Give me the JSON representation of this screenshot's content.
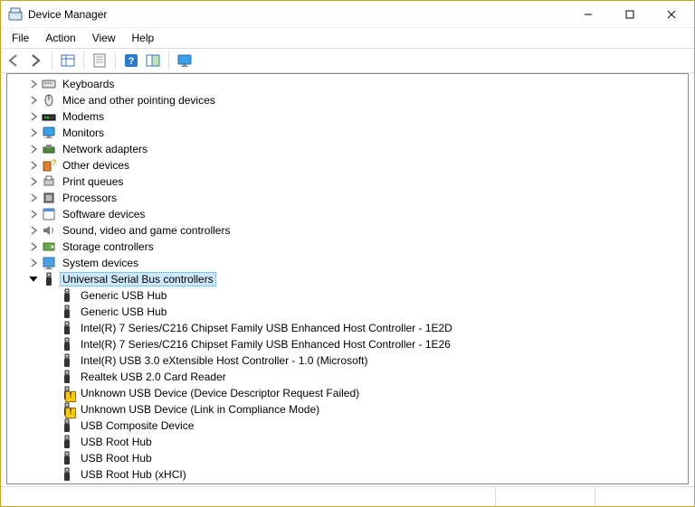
{
  "window": {
    "title": "Device Manager"
  },
  "menu": {
    "file": "File",
    "action": "Action",
    "view": "View",
    "help": "Help"
  },
  "categories": [
    {
      "icon": "keyboard",
      "label": "Keyboards"
    },
    {
      "icon": "mouse",
      "label": "Mice and other pointing devices"
    },
    {
      "icon": "modem",
      "label": "Modems"
    },
    {
      "icon": "monitor",
      "label": "Monitors"
    },
    {
      "icon": "network",
      "label": "Network adapters"
    },
    {
      "icon": "other",
      "label": "Other devices"
    },
    {
      "icon": "printer",
      "label": "Print queues"
    },
    {
      "icon": "processor",
      "label": "Processors"
    },
    {
      "icon": "software",
      "label": "Software devices"
    },
    {
      "icon": "sound",
      "label": "Sound, video and game controllers"
    },
    {
      "icon": "storage",
      "label": "Storage controllers"
    },
    {
      "icon": "system",
      "label": "System devices"
    }
  ],
  "usb_category": {
    "label": "Universal Serial Bus controllers"
  },
  "usb_children": [
    {
      "icon": "usb",
      "label": "Generic USB Hub"
    },
    {
      "icon": "usb",
      "label": "Generic USB Hub"
    },
    {
      "icon": "usb",
      "label": "Intel(R) 7 Series/C216 Chipset Family USB Enhanced Host Controller - 1E2D"
    },
    {
      "icon": "usb",
      "label": "Intel(R) 7 Series/C216 Chipset Family USB Enhanced Host Controller - 1E26"
    },
    {
      "icon": "usb",
      "label": "Intel(R) USB 3.0 eXtensible Host Controller - 1.0 (Microsoft)"
    },
    {
      "icon": "usb",
      "label": "Realtek USB 2.0 Card Reader"
    },
    {
      "icon": "usb-warn",
      "label": "Unknown USB Device (Device Descriptor Request Failed)"
    },
    {
      "icon": "usb-warn",
      "label": "Unknown USB Device (Link in Compliance Mode)"
    },
    {
      "icon": "usb",
      "label": "USB Composite Device"
    },
    {
      "icon": "usb",
      "label": "USB Root Hub"
    },
    {
      "icon": "usb",
      "label": "USB Root Hub"
    },
    {
      "icon": "usb",
      "label": "USB Root Hub (xHCI)"
    }
  ]
}
